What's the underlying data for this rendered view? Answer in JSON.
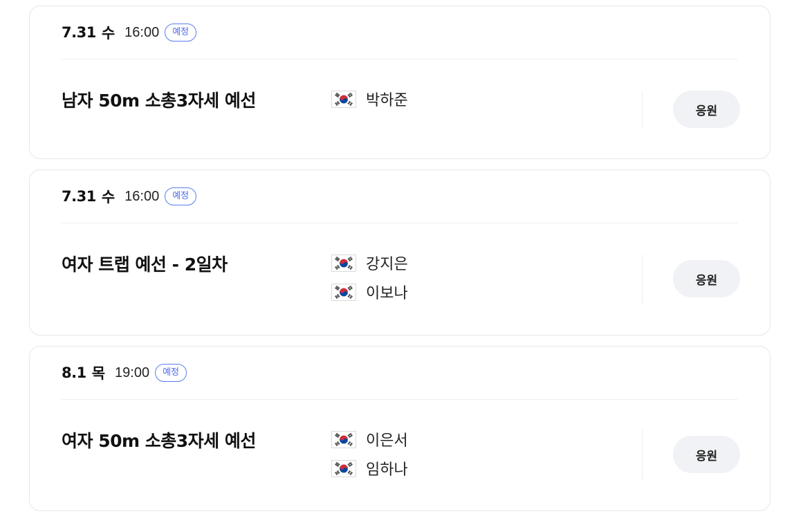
{
  "events": [
    {
      "date": "7.31",
      "day": "수",
      "time": "16:00",
      "status": "예정",
      "title": "남자 50m 소총3자세 예선",
      "athletes": [
        {
          "flag": "korea-flag-icon",
          "name": "박하준"
        }
      ],
      "cheer_label": "응원"
    },
    {
      "date": "7.31",
      "day": "수",
      "time": "16:00",
      "status": "예정",
      "title": "여자 트랩 예선 - 2일차",
      "athletes": [
        {
          "flag": "korea-flag-icon",
          "name": "강지은"
        },
        {
          "flag": "korea-flag-icon",
          "name": "이보나"
        }
      ],
      "cheer_label": "응원"
    },
    {
      "date": "8.1",
      "day": "목",
      "time": "19:00",
      "status": "예정",
      "title": "여자 50m 소총3자세 예선",
      "athletes": [
        {
          "flag": "korea-flag-icon",
          "name": "이은서"
        },
        {
          "flag": "korea-flag-icon",
          "name": "임하나"
        }
      ],
      "cheer_label": "응원"
    }
  ],
  "colors": {
    "badge_accent": "#4a6bea",
    "button_bg": "#f1f2f5",
    "card_border": "#e6e7ea"
  }
}
